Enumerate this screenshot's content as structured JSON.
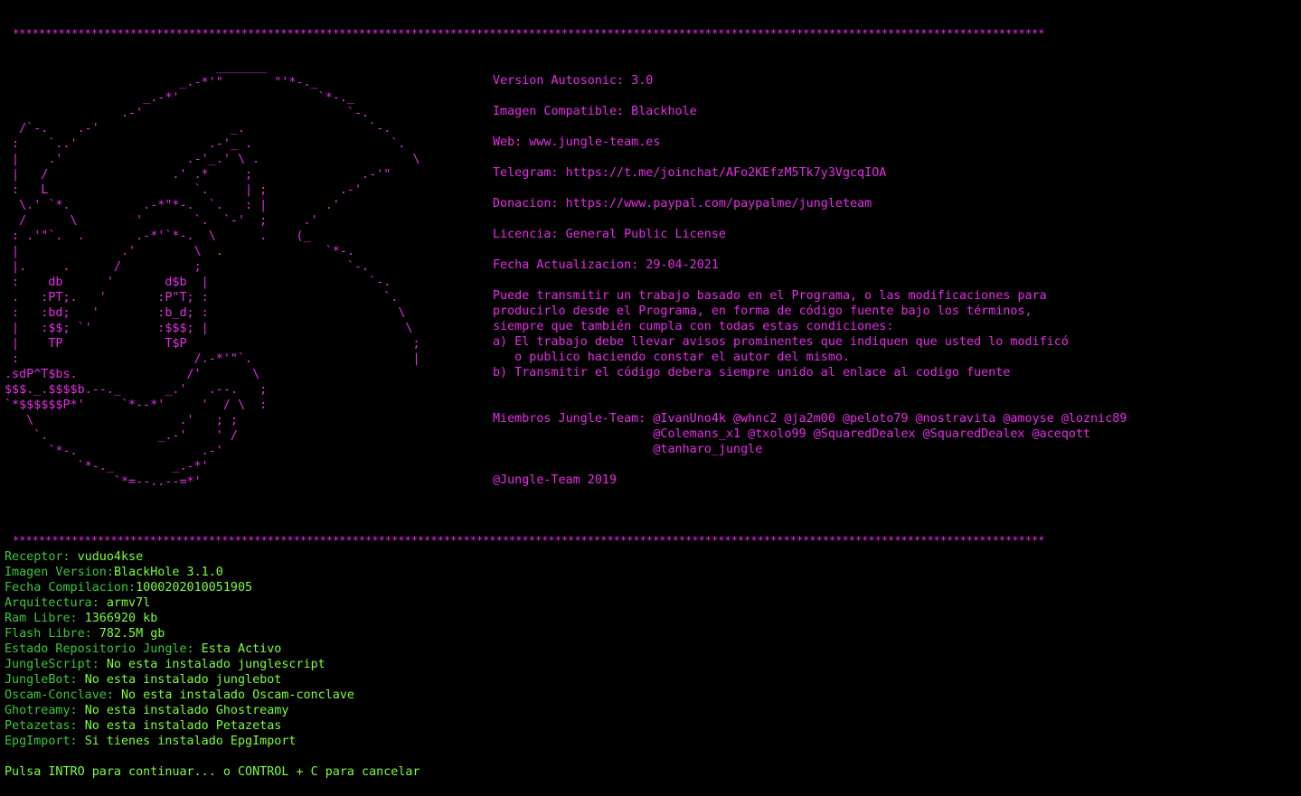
{
  "colors": {
    "background": "#000000",
    "magenta": "#e62ee6",
    "label_green": "#3cc83c",
    "value_green": "#7dff3a"
  },
  "separator": "**************************************************************************************************************************************************************",
  "ascii_art": "                             _______\n                        _.-*'\"       \"'*-._\n                   _.-*'                   `*-._\n                .-'                            `-.\n  /`-.    .-'                  _.                 `-.\n :    `..'                  .-'_ .                   `.\n |    .'                 .-'_.' \\ .                     \\\n |   /                 .' .*     ;               .-'\"\n :   L                    `.     | ;          .-'\n  \\.' `*.          .-*\"*-.  `.   : |        .'\n  /      \\        '       `.  `-'  ;     .'\n : .'\"`.  .       .-*'`*-.  \\      .    (_\n |              .'        \\  .              `*-.\n |.     .      /          ;                    `-.\n :    db      '       d$b  |                      `-.\n .   :PT;.   '       :P\"T; :                        `.\n :   :bd;   '        :b_d; :                          \\\n |   :$$; `'         :$$$; |                           \\\n |    TP              T$P                               ;\n :                        /.-*'\"`.                      |\n.sdP^T$bs.               /'       \\\n$$$._.$$$$b.--._      _.'   .--.   ;\n`*$$$$$$P*'     `*--*'     '  / \\  :\n   \\                    .'   ; ;\n    `.               _.-'    ' /\n      `*-.                 .-'\n          `*-._        _.-*'\n               `*=--..--=*'",
  "info": {
    "version": "Version Autosonic: 3.0",
    "image": "Imagen Compatible: Blackhole",
    "web": "Web: www.jungle-team.es",
    "telegram": "Telegram: https://t.me/joinchat/AFo2KEfzM5Tk7y3VgcqIOA",
    "donation": "Donacion: https://www.paypal.com/paypalme/jungleteam",
    "license": "Licencia: General Public License",
    "updated": "Fecha Actualizacion: 29-04-2021",
    "license_text": [
      "Puede transmitir un trabajo basado en el Programa, o las modificaciones para",
      "producirlo desde el Programa, en forma de código fuente bajo los términos,",
      "siempre que también cumpla con todas estas condiciones:",
      "a) El trabajo debe llevar avisos prominentes que indiquen que usted lo modificó",
      "   o publico haciendo constar el autor del mismo.",
      "b) Transmitir el código debera siempre unido al enlace al codigo fuente"
    ],
    "members": [
      "Miembros Jungle-Team: @IvanUno4k @whnc2 @ja2m00 @peloto79 @nostravita @amoyse @loznic89",
      "                      @Colemans_x1 @txolo99 @SquaredDealex @SquaredDealex @aceqott",
      "                      @tanharo_jungle"
    ],
    "footer": "@Jungle-Team 2019"
  },
  "system": [
    {
      "label": "Receptor: ",
      "value": "vuduo4kse"
    },
    {
      "label": "Imagen Version:",
      "value": "BlackHole 3.1.0"
    },
    {
      "label": "Fecha Compilacion:",
      "value": "1000202010051905"
    },
    {
      "label": "Arquitectura: ",
      "value": "armv7l"
    },
    {
      "label": "Ram Libre: ",
      "value": "1366920 kb"
    },
    {
      "label": "Flash Libre: ",
      "value": "782.5M gb"
    },
    {
      "label": "Estado Repositorio Jungle: ",
      "value": "Esta Activo"
    },
    {
      "label": "JungleScript: ",
      "value": "No esta instalado junglescript"
    },
    {
      "label": "JungleBot: ",
      "value": "No esta instalado junglebot"
    },
    {
      "label": "Oscam-Conclave: ",
      "value": "No esta instalado Oscam-conclave"
    },
    {
      "label": "Ghotreamy: ",
      "value": "No esta instalado Ghostreamy"
    },
    {
      "label": "Petazetas: ",
      "value": "No esta instalado Petazetas"
    },
    {
      "label": "EpgImport: ",
      "value": "Si tienes instalado EpgImport"
    }
  ],
  "prompt": "Pulsa INTRO para continuar... o CONTROL + C para cancelar"
}
